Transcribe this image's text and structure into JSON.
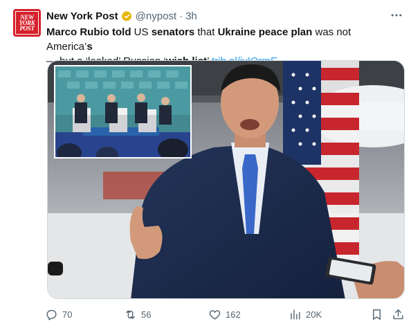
{
  "tweet": {
    "avatar_text": [
      "NEW",
      "YORK",
      "POST"
    ],
    "display_name": "New York Post",
    "handle": "@nypost",
    "separator": "·",
    "time": "3h",
    "text_segments": {
      "s1": "Marco Rubio told",
      "s2": " US ",
      "s3": "senators",
      "s4": " that ",
      "s5": "Ukraine peace plan",
      "s6": " was not America’",
      "s7": "s",
      "s8": "— but a ‘leaked’ Russian ‘",
      "s9": "wish list",
      "s10": "’ ",
      "link": "trib.al/iyIOrmE"
    }
  },
  "actions": {
    "replies": "70",
    "reposts": "56",
    "likes": "162",
    "views": "20K"
  },
  "icons": {
    "verified": "gold-verified-badge-icon",
    "more": "more-dots-icon",
    "reply": "reply-bubble-icon",
    "repost": "repost-arrows-icon",
    "like": "heart-icon",
    "views": "views-bar-chart-icon",
    "bookmark": "bookmark-icon",
    "share": "share-upload-icon"
  },
  "colors": {
    "accent": "#1d9bf0",
    "brand_red": "#d6202b",
    "verified_gold": "#e8b50c",
    "muted": "#536471"
  }
}
